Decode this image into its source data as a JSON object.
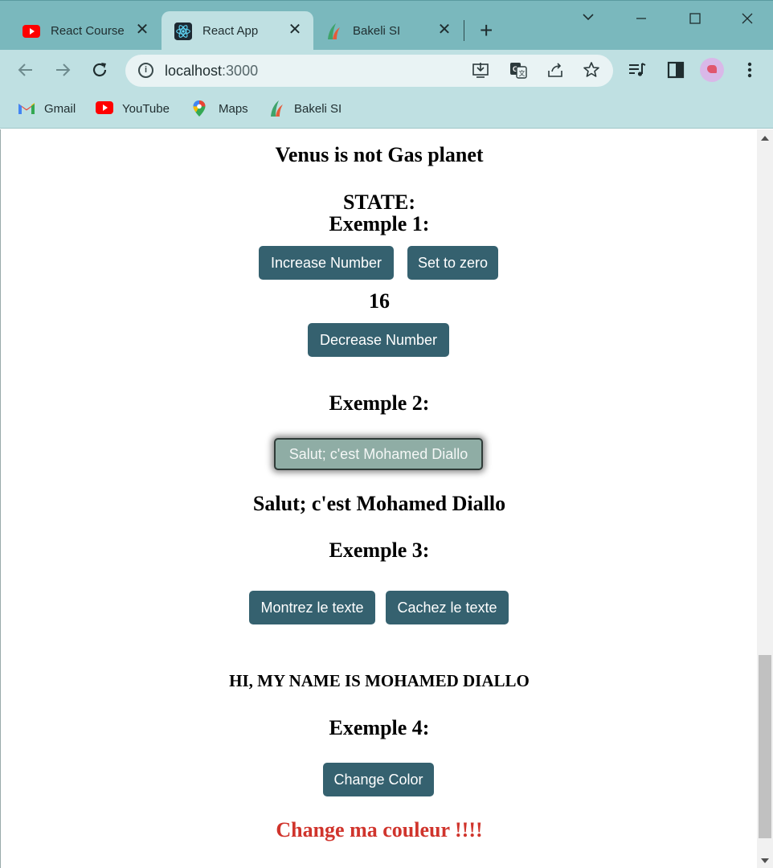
{
  "browser": {
    "tabs": [
      {
        "title": "React Course",
        "icon": "youtube-icon",
        "active": false
      },
      {
        "title": "React App",
        "icon": "react-icon",
        "active": true
      },
      {
        "title": "Bakeli SI",
        "icon": "bakeli-icon",
        "active": false
      }
    ],
    "close_glyph": "✕",
    "new_tab_glyph": "+",
    "url_host": "localhost",
    "url_port": ":3000",
    "bookmarks": [
      {
        "label": "Gmail",
        "icon": "gmail-icon"
      },
      {
        "label": "YouTube",
        "icon": "youtube-icon"
      },
      {
        "label": "Maps",
        "icon": "maps-icon"
      },
      {
        "label": "Bakeli SI",
        "icon": "bakeli-icon"
      }
    ],
    "colors": {
      "tabbar": "#7ab8bd",
      "toolbar": "#bfe0e2",
      "accent_button": "#35616f"
    }
  },
  "page": {
    "planet_heading": "Venus is not Gas planet",
    "state_heading": "STATE:",
    "example1": {
      "heading": "Exemple 1:",
      "increase_label": "Increase Number",
      "reset_label": "Set to zero",
      "count": "16",
      "decrease_label": "Decrease Number"
    },
    "example2": {
      "heading": "Exemple 2:",
      "button_label": "Salut; c'est Mohamed Diallo",
      "output_text": "Salut; c'est Mohamed Diallo"
    },
    "example3": {
      "heading": "Exemple 3:",
      "show_label": "Montrez le texte",
      "hide_label": "Cachez le texte",
      "revealed_text": "HI, MY NAME IS MOHAMED DIALLO"
    },
    "example4": {
      "heading": "Exemple 4:",
      "button_label": "Change Color",
      "colored_text": "Change ma couleur !!!!",
      "text_color": "#d0342c"
    }
  }
}
